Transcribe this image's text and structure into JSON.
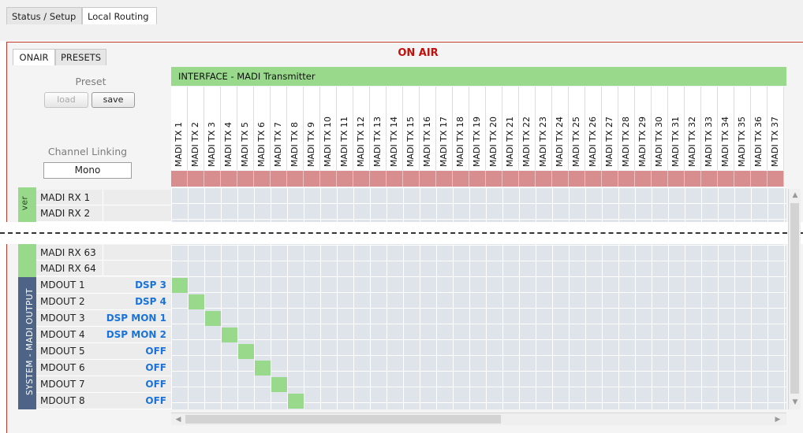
{
  "top_tabs": {
    "status_setup": "Status / Setup",
    "local_routing": "Local Routing"
  },
  "onair_label": "ON AIR",
  "sub_tabs": {
    "onair": "ONAIR",
    "presets": "PRESETS"
  },
  "preset": {
    "label": "Preset",
    "load": "load",
    "save": "save"
  },
  "channel_linking": {
    "label": "Channel Linking",
    "value": "Mono"
  },
  "interface_header": "INTERFACE - MADI Transmitter",
  "columns": [
    "MADI TX 1",
    "MADI TX 2",
    "MADI TX 3",
    "MADI TX 4",
    "MADI TX 5",
    "MADI TX 6",
    "MADI TX 7",
    "MADI TX 8",
    "MADI TX 9",
    "MADI TX 10",
    "MADI TX 11",
    "MADI TX 12",
    "MADI TX 13",
    "MADI TX 14",
    "MADI TX 15",
    "MADI TX 16",
    "MADI TX 17",
    "MADI TX 18",
    "MADI TX 19",
    "MADI TX 20",
    "MADI TX 21",
    "MADI TX 22",
    "MADI TX 23",
    "MADI TX 24",
    "MADI TX 25",
    "MADI TX 26",
    "MADI TX 27",
    "MADI TX 28",
    "MADI TX 29",
    "MADI TX 30",
    "MADI TX 31",
    "MADI TX 32",
    "MADI TX 33",
    "MADI TX 34",
    "MADI TX 35",
    "MADI TX 36",
    "MADI TX 37"
  ],
  "group_receiver": {
    "label": "ver",
    "rows_top": [
      "MADI RX 1",
      "MADI RX 2"
    ],
    "rows_bottom": [
      "MADI RX 63",
      "MADI RX 64"
    ]
  },
  "group_output": {
    "label": "SYSTEM - MADI OUTPUT",
    "rows": [
      {
        "name": "MDOUT 1",
        "assign": "DSP 3",
        "active_col": 0
      },
      {
        "name": "MDOUT 2",
        "assign": "DSP 4",
        "active_col": 1
      },
      {
        "name": "MDOUT 3",
        "assign": "DSP MON 1",
        "active_col": 2
      },
      {
        "name": "MDOUT 4",
        "assign": "DSP MON 2",
        "active_col": 3
      },
      {
        "name": "MDOUT 5",
        "assign": "OFF",
        "active_col": 4
      },
      {
        "name": "MDOUT 6",
        "assign": "OFF",
        "active_col": 5
      },
      {
        "name": "MDOUT 7",
        "assign": "OFF",
        "active_col": 6
      },
      {
        "name": "MDOUT 8",
        "assign": "OFF",
        "active_col": 7
      }
    ]
  },
  "colors": {
    "accent_green": "#98d98b",
    "header_pink": "#d88e8e",
    "group_output_bg": "#4d6487",
    "assign_blue": "#1a73d9",
    "onair_red": "#c0100b"
  },
  "icons": {
    "scroll_up": "▲",
    "scroll_down": "▼",
    "scroll_left": "◀",
    "scroll_right": "▶"
  }
}
